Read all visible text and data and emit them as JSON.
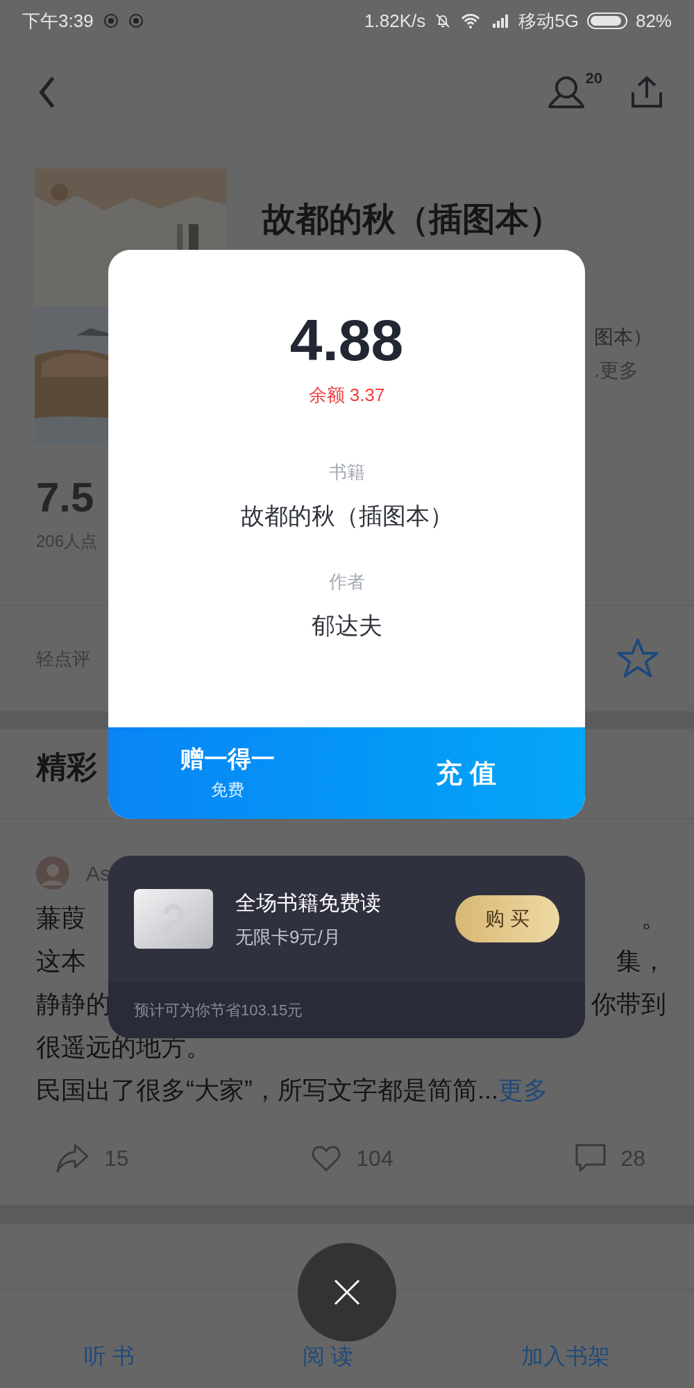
{
  "status_bar": {
    "time": "下午3:39",
    "speed": "1.82K/s",
    "carrier": "移动5G",
    "battery": "82%"
  },
  "header": {
    "followers": "20"
  },
  "book": {
    "title": "故都的秋（插图本）",
    "subtitle_fragment": "图本）",
    "more_fragment": ".更多",
    "score": "7.5",
    "ratings_fragment": "206人点",
    "rate_prompt_fragment": "轻点评"
  },
  "review_section": {
    "heading_fragment": "精彩"
  },
  "review": {
    "author_fragment": "As",
    "lines": [
      {
        "left": "蒹葭",
        "right": "。"
      },
      {
        "left": "这本",
        "right": "集，"
      },
      {
        "left": "静静的",
        "right": "你带到"
      },
      {
        "left": "很遥远的地方。"
      }
    ],
    "last_line": "民国出了很多“大家”，所写文字都是简简...",
    "more": "更多",
    "shares": "15",
    "likes": "104",
    "comments": "28"
  },
  "bottom_tabs": [
    {
      "label": "听 书"
    },
    {
      "label": "阅 读"
    },
    {
      "label": "加入书架"
    }
  ],
  "dialog": {
    "price": "4.88",
    "balance": "余额 3.37",
    "fields": [
      {
        "label": "书籍",
        "value": "故都的秋（插图本）"
      },
      {
        "label": "作者",
        "value": "郁达夫"
      }
    ],
    "gift": {
      "title": "赠一得一",
      "note": "免费"
    },
    "recharge": "充 值"
  },
  "promo": {
    "title": "全场书籍免费读",
    "subtitle": "无限卡9元/月",
    "buy": "购 买",
    "savings": "预计可为你节省103.15元"
  }
}
